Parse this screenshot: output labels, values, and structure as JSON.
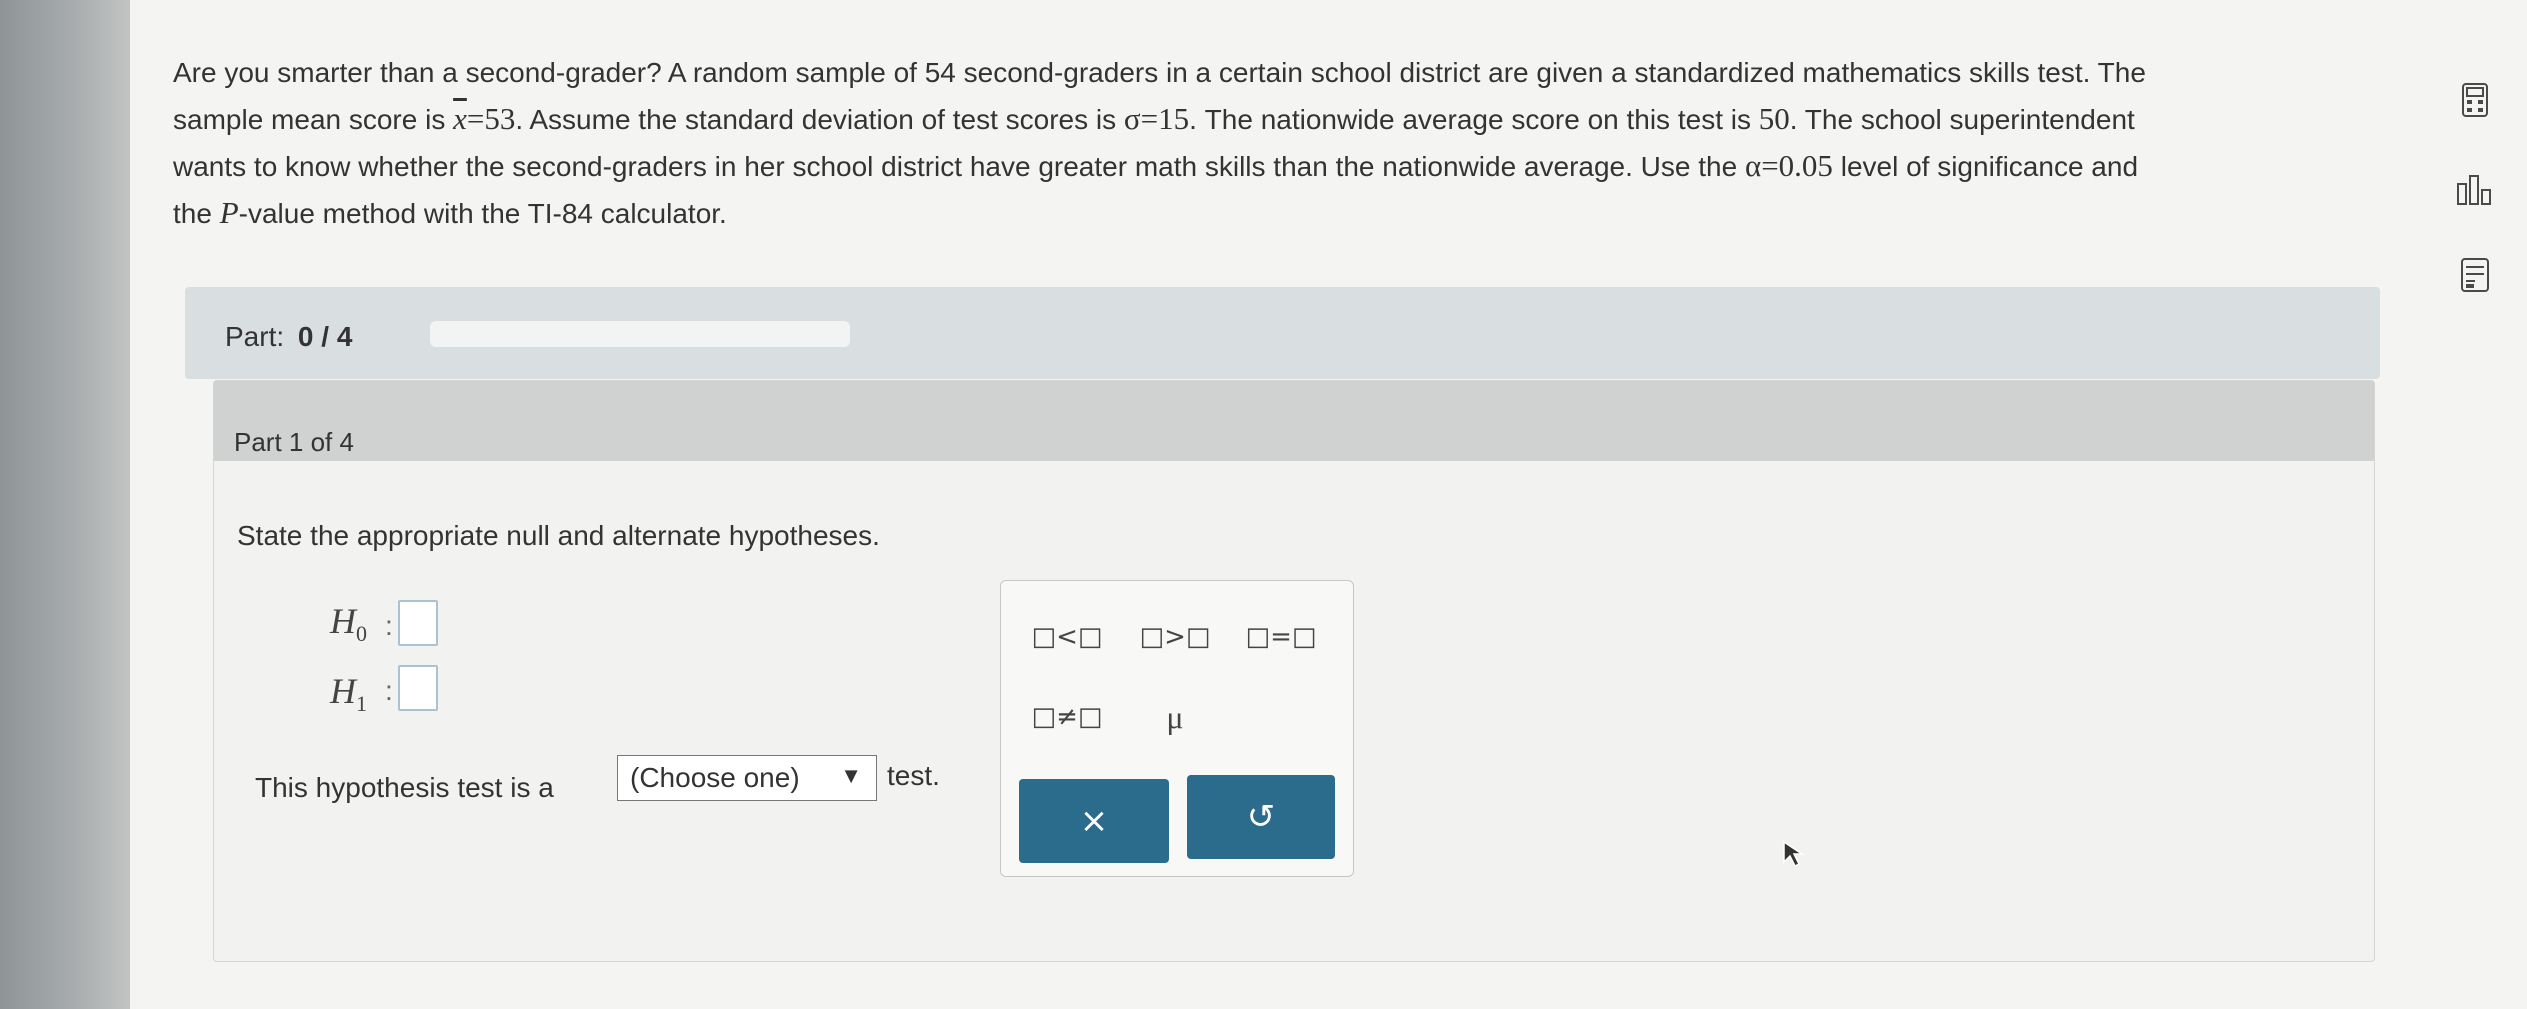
{
  "problem": {
    "line1": "Are you smarter than a second-grader? A random sample of 54 second-graders in a certain school district are given a standardized mathematics skills test. The",
    "line2_prefix": "sample mean score is ",
    "xbar_symbol": "x",
    "xbar_value": "=53",
    "line2_mid": ". Assume the standard deviation of test scores is ",
    "sigma_value": "σ=15",
    "line2_mid2": ". The nationwide average score on this test is ",
    "nation_avg": "50",
    "line2_suffix": ". The school superintendent",
    "line3_prefix": "wants to know whether the second-graders in her school district have greater math skills than the nationwide average. Use the ",
    "alpha_value": "α=0.05",
    "line3_suffix": " level of significance and",
    "line4_prefix": "the ",
    "p_symbol": "P",
    "line4_suffix": "-value method with the TI-84 calculator."
  },
  "part_bar": {
    "label": "Part:",
    "progress": "0 / 4",
    "progress_fraction": 0
  },
  "part_header": "Part 1 of 4",
  "instruction": "State the appropriate null and alternate hypotheses.",
  "hypotheses": {
    "null_letter": "H",
    "null_sub": "0",
    "alt_letter": "H",
    "alt_sub": "1",
    "colon": ":"
  },
  "test_sentence": {
    "prefix": "This hypothesis test is a",
    "select_value": "(Choose one)",
    "suffix": "test."
  },
  "palette": {
    "keys": [
      "□<□",
      "□>□",
      "□=□",
      "□≠□",
      "μ"
    ],
    "clear_label": "×",
    "undo_label": "↺"
  },
  "icons": [
    "calculator-icon",
    "bar-chart-icon",
    "data-table-icon"
  ],
  "colors": {
    "button_blue": "#2b6b8b",
    "answer_border": "#a9c2d6",
    "part_bar": "#d9dfe1"
  }
}
